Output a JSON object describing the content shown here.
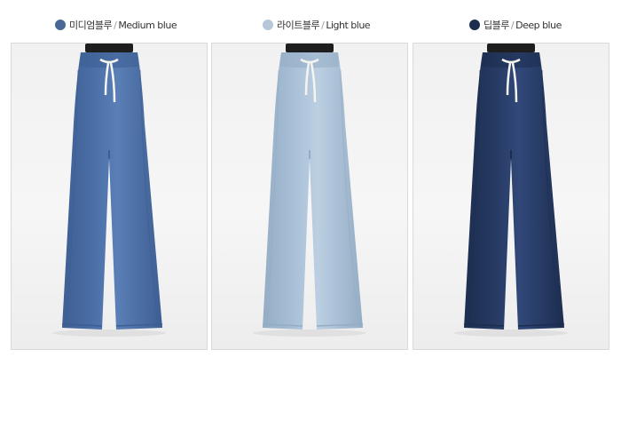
{
  "colors": [
    {
      "name_kr": "미디엄블루",
      "separator": "/",
      "name_en": "Medium blue",
      "swatch": "#4a6797",
      "pants_base": "#4a6ea6",
      "pants_shade": "#3d5e92",
      "pants_light": "#5a7fb6"
    },
    {
      "name_kr": "라이트블루",
      "separator": "/",
      "name_en": "Light blue",
      "swatch": "#b5c7d8",
      "pants_base": "#a7bfd6",
      "pants_shade": "#94adc5",
      "pants_light": "#bccfe2"
    },
    {
      "name_kr": "딥블루",
      "separator": "/",
      "name_en": "Deep blue",
      "swatch": "#1d2d4d",
      "pants_base": "#263a62",
      "pants_shade": "#1c2d4f",
      "pants_light": "#314879"
    }
  ]
}
